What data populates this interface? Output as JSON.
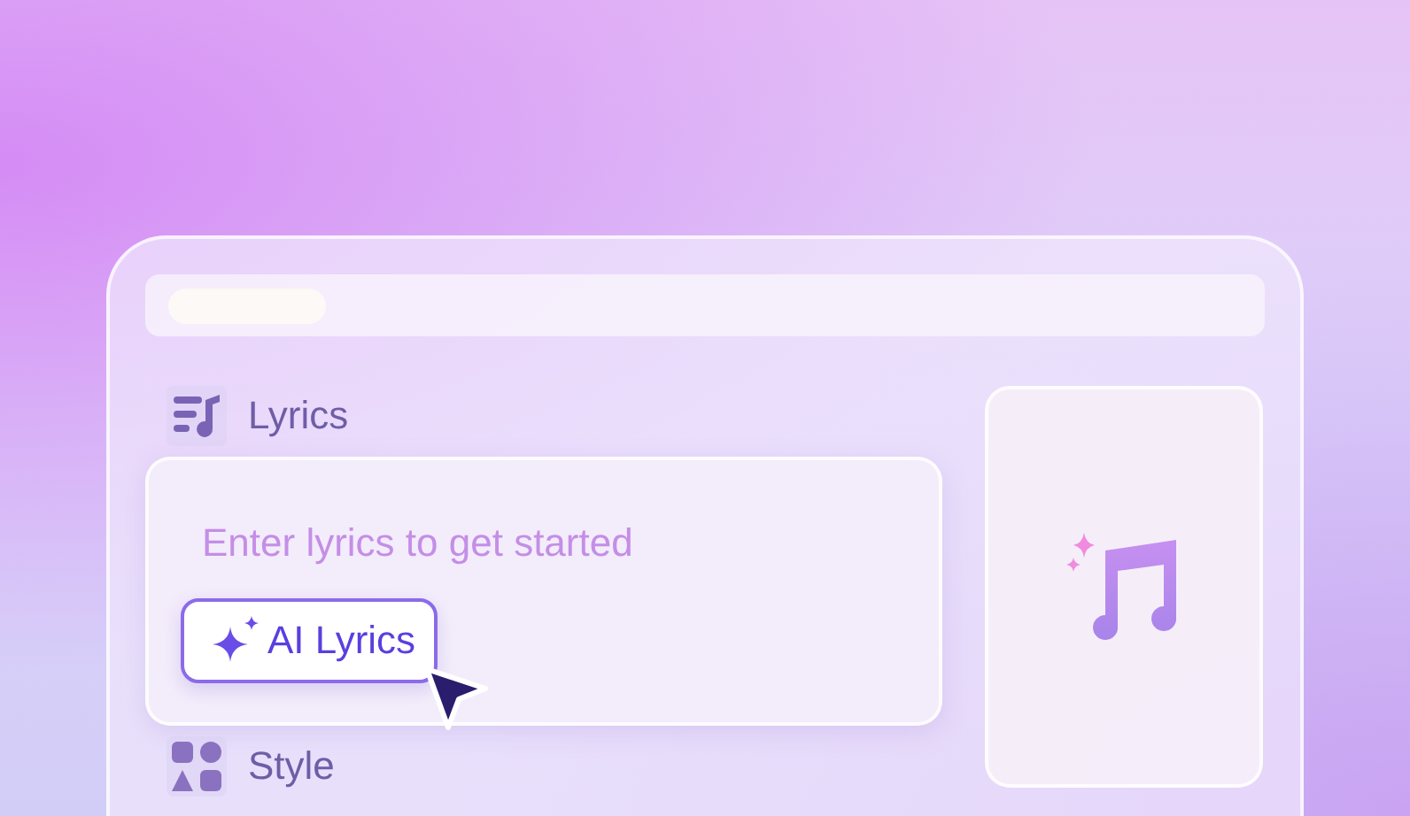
{
  "lyrics": {
    "label": "Lyrics",
    "placeholder": "Enter lyrics to get started",
    "ai_button": "AI Lyrics"
  },
  "style": {
    "label": "Style"
  }
}
